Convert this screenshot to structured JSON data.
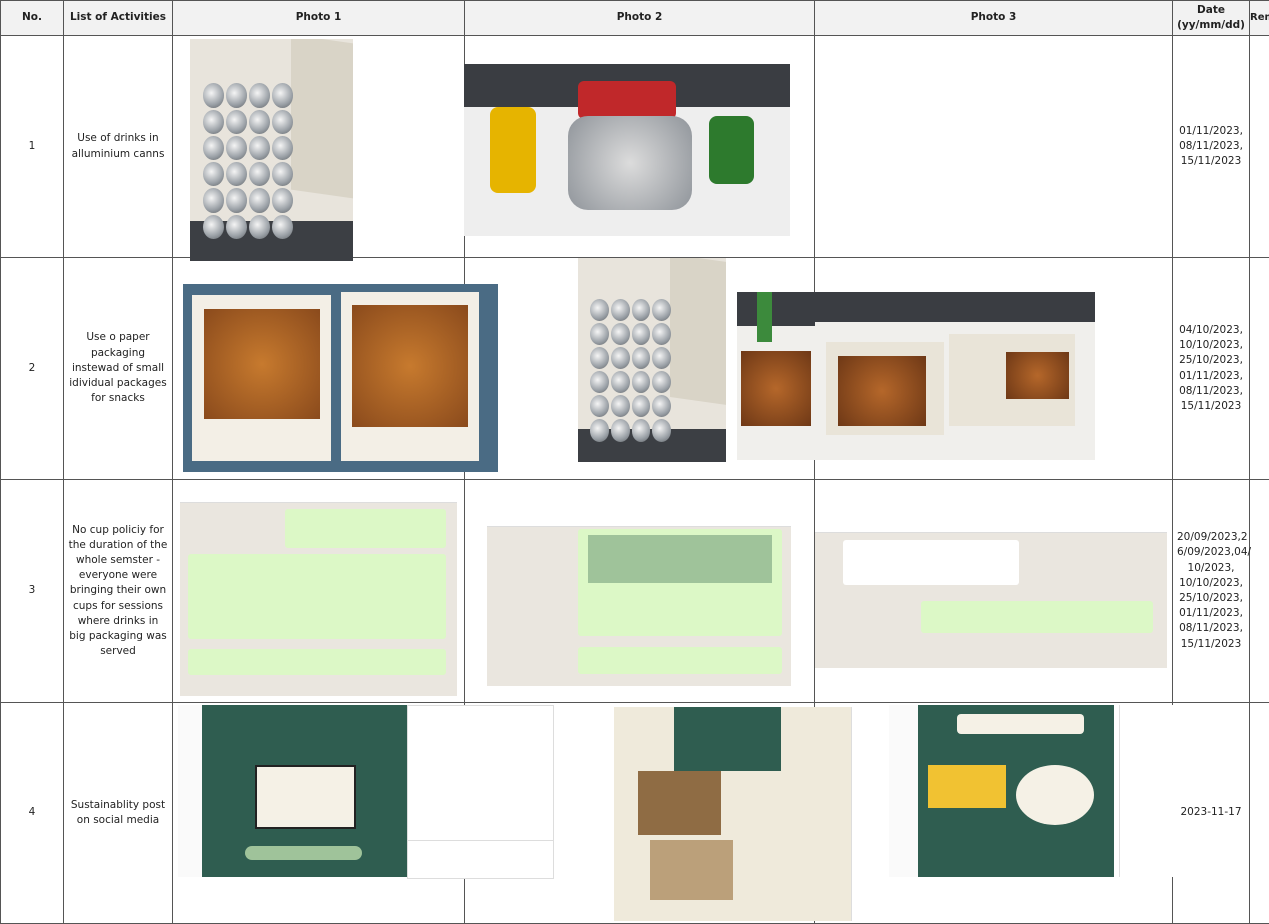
{
  "headers": {
    "no": "No.",
    "activities": "List of Activities",
    "photo1": "Photo 1",
    "photo2": "Photo 2",
    "photo3": "Photo 3",
    "date_line1": "Date",
    "date_line2": "(yy/mm/dd)",
    "remarks": "Remarks"
  },
  "rows": [
    {
      "no": "1",
      "activity": "Use of drinks in alluminium canns",
      "dates": [
        "01/11/2023,",
        "08/11/2023,",
        "15/11/2023"
      ],
      "remarks": ""
    },
    {
      "no": "2",
      "activity": "Use o paper packaging instewad of small idividual packages for snacks",
      "dates": [
        "04/10/2023,",
        "10/10/2023,",
        "25/10/2023,",
        "01/11/2023,",
        "08/11/2023,",
        "15/11/2023"
      ],
      "remarks": ""
    },
    {
      "no": "3",
      "activity": "No cup policiy for the duration of the whole semster - everyone were bringing their own cups for sessions where drinks in big packaging was served",
      "dates": [
        "20/09/2023,2",
        "6/09/2023,04/",
        "10/2023,",
        "10/10/2023,",
        "25/10/2023,",
        "01/11/2023,",
        "08/11/2023,",
        "15/11/2023"
      ],
      "remarks": ""
    },
    {
      "no": "4",
      "activity": "Sustainablity post on social media",
      "dates": [
        "2023-11-17"
      ],
      "remarks": ""
    }
  ]
}
